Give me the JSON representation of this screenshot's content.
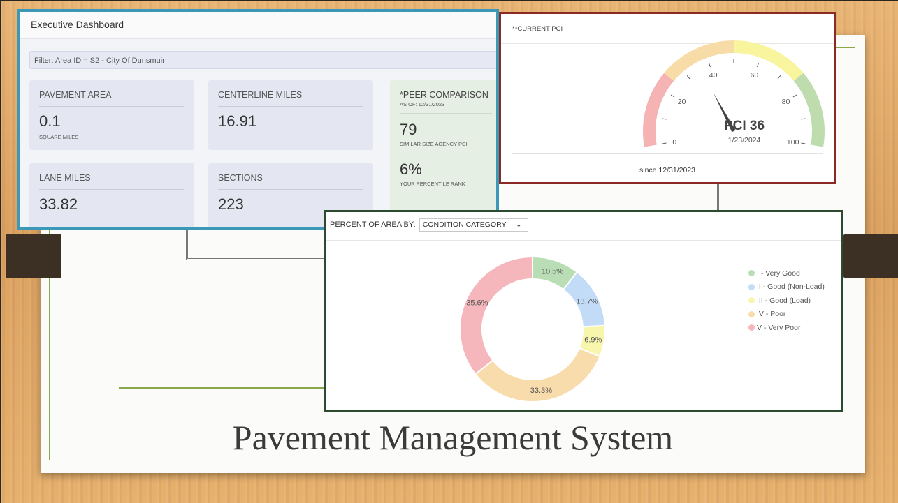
{
  "slide": {
    "title": "Pavement Management System"
  },
  "exec": {
    "header": "Executive Dashboard",
    "filter": "Filter: Area ID = S2 - City Of Dunsmuir",
    "pavement_area": {
      "label": "PAVEMENT AREA",
      "value": "0.1",
      "unit": "SQUARE MILES"
    },
    "centerline_miles": {
      "label": "CENTERLINE MILES",
      "value": "16.91"
    },
    "lane_miles": {
      "label": "LANE MILES",
      "value": "33.82"
    },
    "sections": {
      "label": "SECTIONS",
      "value": "223"
    },
    "peer": {
      "title": "*PEER COMPARISON",
      "as_of": "AS OF: 12/31/2023",
      "agency_pci": "79",
      "agency_pci_label": "SIMILAR SIZE AGENCY PCI",
      "percentile": "6%",
      "percentile_label": "YOUR PERCENTILE RANK"
    }
  },
  "pci": {
    "title": "**CURRENT PCI",
    "value": 36,
    "value_label": "PCI 36",
    "date": "1/23/2024",
    "since": "since 12/31/2023",
    "ticks": [
      "0",
      "20",
      "40",
      "60",
      "80",
      "100"
    ],
    "band_colors": [
      "#f5b3b3",
      "#f8dca8",
      "#f9f49e",
      "#bfdcae"
    ]
  },
  "donut": {
    "header_label": "PERCENT OF AREA BY:",
    "select_value": "CONDITION CATEGORY",
    "legend": [
      {
        "label": "I - Very Good",
        "color": "#b9ddb4"
      },
      {
        "label": "II - Good (Non-Load)",
        "color": "#c2dcf8"
      },
      {
        "label": "III - Good (Load)",
        "color": "#f8f6ad"
      },
      {
        "label": "IV - Poor",
        "color": "#f9dcab"
      },
      {
        "label": "V - Very Poor",
        "color": "#f5b7bb"
      }
    ]
  },
  "chart_data": {
    "type": "pie",
    "categories": [
      "I - Very Good",
      "II - Good (Non-Load)",
      "III - Good (Load)",
      "IV - Poor",
      "V - Very Poor"
    ],
    "values": [
      10.5,
      13.7,
      6.9,
      33.3,
      35.6
    ],
    "labels": [
      "10.5%",
      "13.7%",
      "6.9%",
      "33.3%",
      "35.6%"
    ],
    "colors": [
      "#b9ddb4",
      "#c2dcf8",
      "#f8f6ad",
      "#f9dcab",
      "#f5b7bb"
    ],
    "legend_position": "right"
  }
}
